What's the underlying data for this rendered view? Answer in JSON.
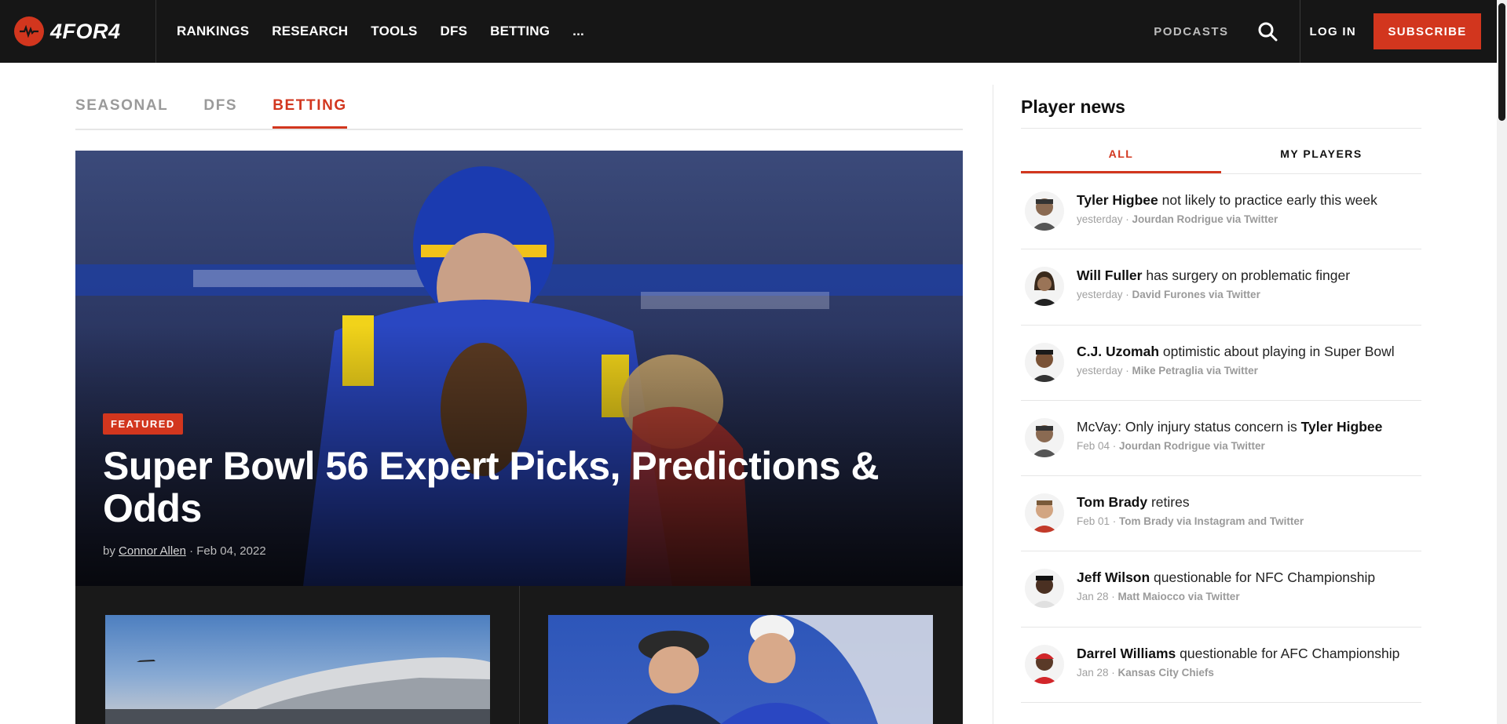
{
  "brand": {
    "logo_text": "4FOR4"
  },
  "nav": {
    "items": [
      "RANKINGS",
      "RESEARCH",
      "TOOLS",
      "DFS",
      "BETTING",
      "..."
    ],
    "podcasts": "PODCASTS",
    "login": "LOG IN",
    "subscribe": "SUBSCRIBE"
  },
  "tabs": {
    "items": [
      "SEASONAL",
      "DFS",
      "BETTING"
    ],
    "active": "BETTING"
  },
  "featured": {
    "badge": "FEATURED",
    "title": "Super Bowl 56 Expert Picks, Predictions & Odds",
    "by": "by",
    "author": "Connor Allen",
    "date": "· Feb 04, 2022"
  },
  "sidebar": {
    "title": "Player news",
    "tabs": [
      "ALL",
      "MY PLAYERS"
    ],
    "news": [
      {
        "pre": "",
        "player": "Tyler Higbee",
        "post": " not likely to practice early this week",
        "when": "yesterday",
        "source": "Jourdan Rodrigue via Twitter"
      },
      {
        "pre": "",
        "player": "Will Fuller",
        "post": " has surgery on problematic finger",
        "when": "yesterday",
        "source": "David Furones via Twitter"
      },
      {
        "pre": "",
        "player": "C.J. Uzomah",
        "post": " optimistic about playing in Super Bowl",
        "when": "yesterday",
        "source": "Mike Petraglia via Twitter"
      },
      {
        "pre": "McVay: Only injury status concern is ",
        "player": "Tyler Higbee",
        "post": "",
        "when": "Feb 04",
        "source": "Jourdan Rodrigue via Twitter"
      },
      {
        "pre": "",
        "player": "Tom Brady",
        "post": " retires",
        "when": "Feb 01",
        "source": "Tom Brady via Instagram and Twitter"
      },
      {
        "pre": "",
        "player": "Jeff Wilson",
        "post": " questionable for NFC Championship",
        "when": "Jan 28",
        "source": "Matt Maiocco via Twitter"
      },
      {
        "pre": "",
        "player": "Darrel Williams",
        "post": " questionable for AFC Championship",
        "when": "Jan 28",
        "source": "Kansas City Chiefs"
      }
    ]
  },
  "colors": {
    "accent": "#d2361e",
    "topbar": "#161616"
  }
}
